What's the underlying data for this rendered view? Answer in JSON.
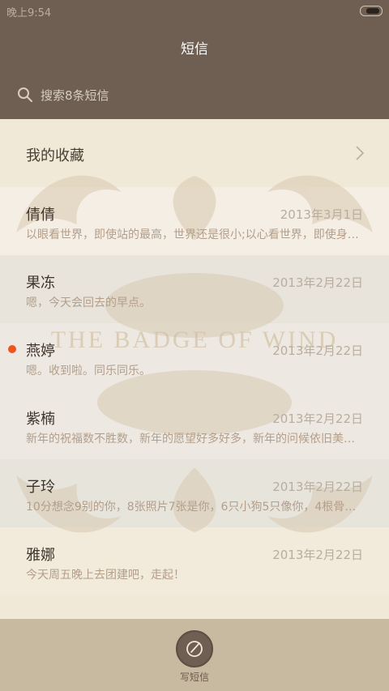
{
  "status_bar": {
    "time": "晚上9:54"
  },
  "header": {
    "title": "短信"
  },
  "search": {
    "placeholder": "搜索8条短信"
  },
  "favorites": {
    "label": "我的收藏"
  },
  "watermark_text": "THE BADGE OF WIND",
  "threads": [
    {
      "name": "倩倩",
      "date": "2013年3月1日",
      "preview": "以眼看世界，即使站的最高，世界还是很小;以心看世界，即使身…",
      "unread": false
    },
    {
      "name": "果冻",
      "date": "2013年2月22日",
      "preview": "嗯，今天会回去的早点。",
      "unread": false
    },
    {
      "name": "燕婷",
      "date": "2013年2月22日",
      "preview": "嗯。收到啦。同乐同乐。",
      "unread": true
    },
    {
      "name": "紫楠",
      "date": "2013年2月22日",
      "preview": "新年的祝福数不胜数，新年的愿望好多好多，新年的问候依旧美…",
      "unread": false
    },
    {
      "name": "子玲",
      "date": "2013年2月22日",
      "preview": "10分想念9别的你，8张照片7张是你，6只小狗5只像你，4根骨…",
      "unread": false
    },
    {
      "name": "雅娜",
      "date": "2013年2月22日",
      "preview": "今天周五晚上去团建吧，走起！",
      "unread": false
    }
  ],
  "compose": {
    "label": "写短信"
  },
  "colors": {
    "header": "#6e5f52",
    "unread": "#f0541e",
    "bottom_bar": "#c8b9a1"
  }
}
